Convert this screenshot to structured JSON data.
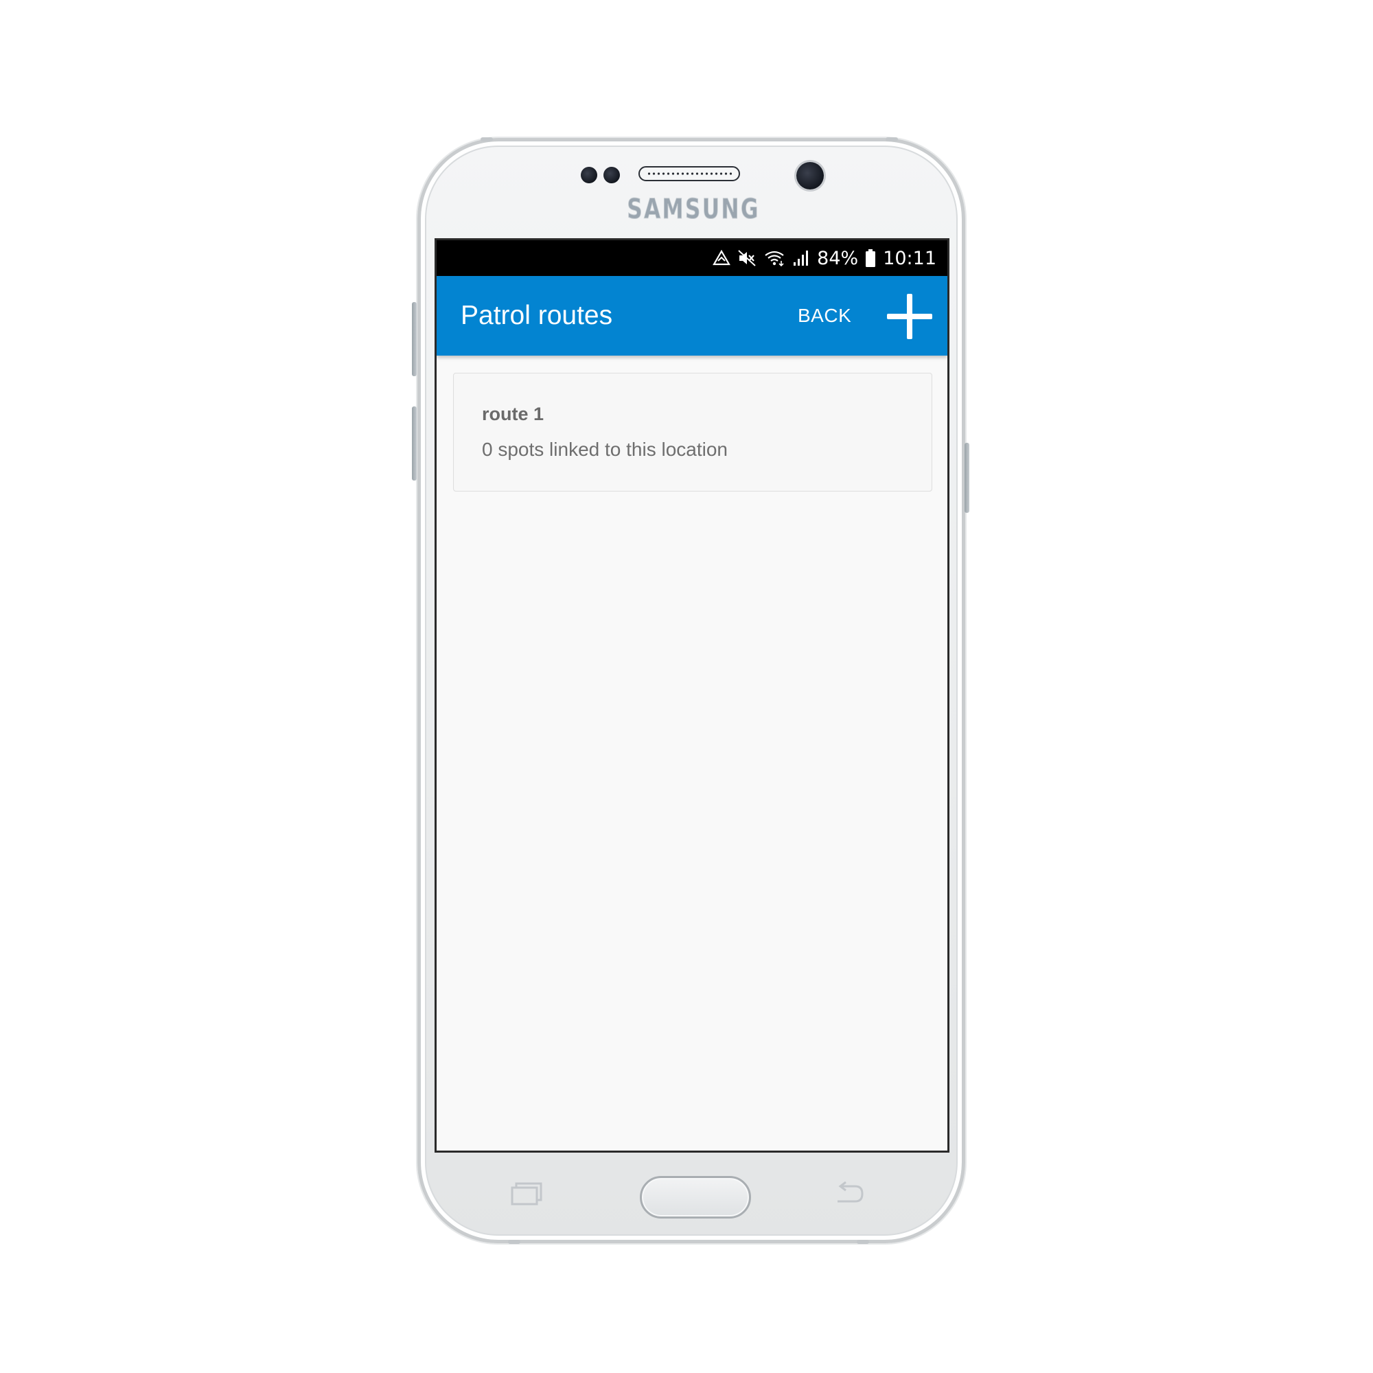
{
  "device": {
    "brand": "SAMSUNG"
  },
  "status_bar": {
    "battery_percent": "84%",
    "time": "10:11",
    "icons": [
      "data-saver-icon",
      "mute-icon",
      "wifi-icon",
      "signal-icon",
      "battery-icon"
    ]
  },
  "app_bar": {
    "title": "Patrol routes",
    "back_label": "BACK",
    "add_icon": "plus-icon",
    "color": "#0384d1"
  },
  "routes": [
    {
      "name": "route 1",
      "description": "0 spots linked to this location"
    }
  ],
  "hardware_keys": [
    "recent-apps-icon",
    "home-button",
    "back-arrow-icon"
  ]
}
